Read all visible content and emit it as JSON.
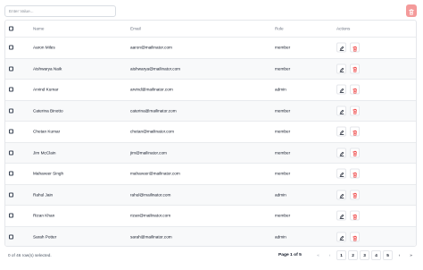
{
  "search": {
    "placeholder": "Enter Value..."
  },
  "table": {
    "headers": {
      "name": "Name",
      "email": "Email",
      "role": "Role",
      "actions": "Actions"
    },
    "rows": [
      {
        "name": "Aaron Miles",
        "email": "aaron@mailinator.com",
        "role": "member"
      },
      {
        "name": "Aishwarya Naik",
        "email": "aishwarya@mailinator.com",
        "role": "member"
      },
      {
        "name": "Arvind Kumar",
        "email": "arvind@mailinator.com",
        "role": "admin"
      },
      {
        "name": "Caterina Binotto",
        "email": "caterina@mailinator.com",
        "role": "member"
      },
      {
        "name": "Chetan Kumar",
        "email": "chetan@mailinator.com",
        "role": "member"
      },
      {
        "name": "Jim McClain",
        "email": "jim@mailinator.com",
        "role": "member"
      },
      {
        "name": "Mahaveer Singh",
        "email": "mahaveer@mailinator.com",
        "role": "member"
      },
      {
        "name": "Rahul Jain",
        "email": "rahul@mailinator.com",
        "role": "admin"
      },
      {
        "name": "Rizan Khan",
        "email": "rizan@mailinator.com",
        "role": "member"
      },
      {
        "name": "Sarah Potter",
        "email": "sarah@mailinator.com",
        "role": "admin"
      }
    ]
  },
  "footer": {
    "selection": "0 of 46 row(s) selected.",
    "page_info": "Page 1 of 5",
    "nav": {
      "first": "«",
      "prev": "‹",
      "next": "›",
      "last": "»"
    },
    "pages": [
      "1",
      "2",
      "3",
      "4",
      "5"
    ]
  },
  "icons": {
    "edit": "edit-icon",
    "delete": "trash-icon",
    "bulk_delete": "trash-icon"
  },
  "colors": {
    "danger": "#ef4444",
    "danger_soft": "#f49a9a",
    "stripe": "#f8f9fa"
  }
}
